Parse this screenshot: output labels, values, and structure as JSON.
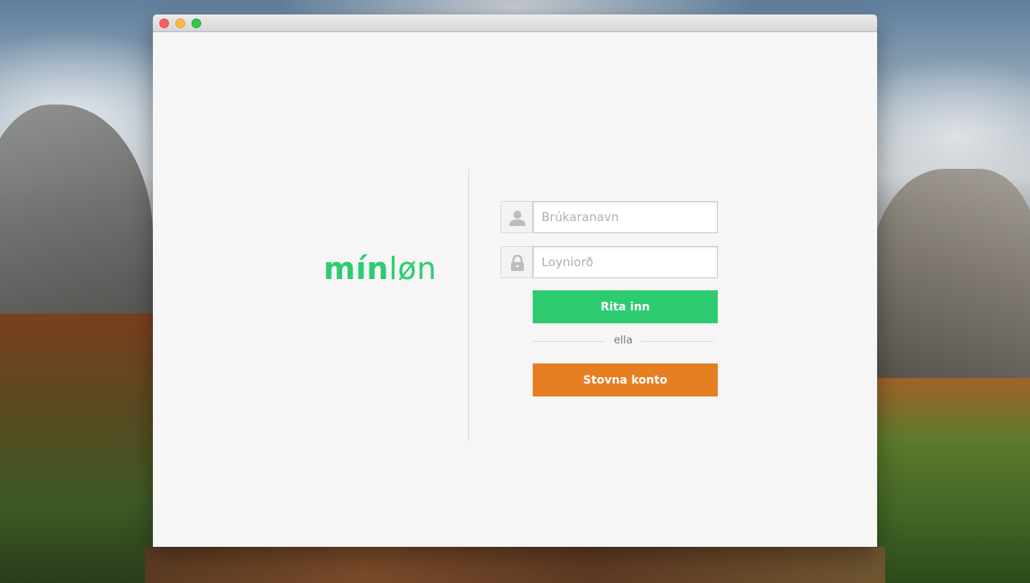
{
  "app": {
    "logo": {
      "bold_part": "mín",
      "light_part": "løn",
      "color": "#2ecc71"
    }
  },
  "login": {
    "username": {
      "placeholder": "Brúkaranavn",
      "value": "",
      "icon": "user-icon"
    },
    "password": {
      "placeholder": "Loyniorð",
      "value": "",
      "icon": "lock-icon"
    },
    "signin_label": "Rita inn",
    "or_label": "ella",
    "create_label": "Stovna konto"
  },
  "colors": {
    "primary": "#2ecc71",
    "secondary": "#e67e22",
    "window_bg": "#f6f6f6"
  }
}
